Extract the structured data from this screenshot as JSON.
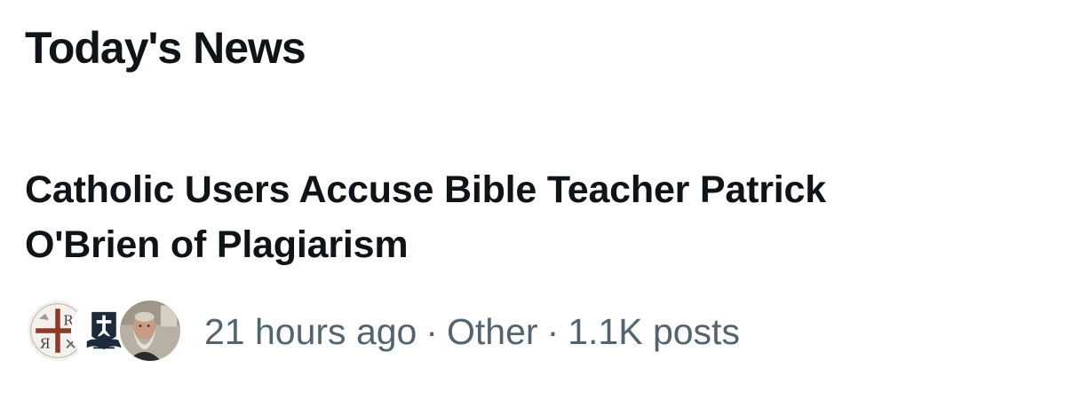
{
  "section": {
    "title": "Today's News"
  },
  "story": {
    "headline_line1": "Catholic Users Accuse Bible Teacher Patrick",
    "headline_line2": "O'Brien of Plagiarism",
    "time": "21 hours ago",
    "separator": "·",
    "category": "Other",
    "post_count": "1.1K posts",
    "avatars": [
      {
        "icon": "chi-rho-cross-logo-icon"
      },
      {
        "icon": "cross-bible-logo-icon"
      },
      {
        "icon": "bearded-man-photo-icon"
      }
    ]
  },
  "colors": {
    "text_primary": "#0f1419",
    "text_secondary": "#536471",
    "background": "#ffffff"
  }
}
